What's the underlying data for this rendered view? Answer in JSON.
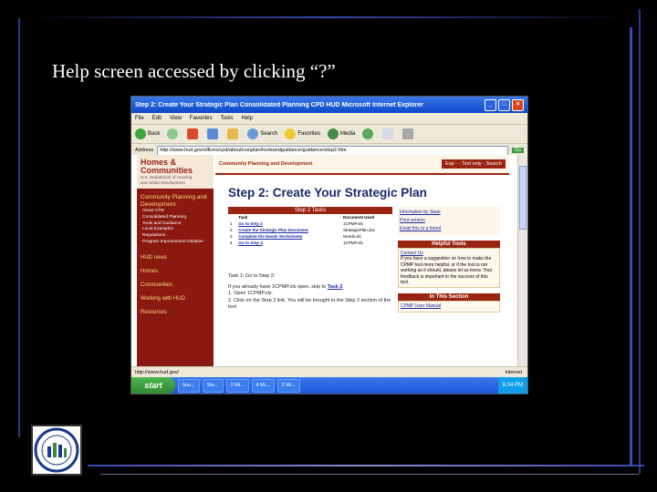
{
  "slide": {
    "title": "Help screen accessed by clicking “?”"
  },
  "window": {
    "title": "Step 2: Create Your Strategic Plan  Consolidated Planning  CPD  HUD  Microsoft Internet Explorer",
    "min": "_",
    "max": "□",
    "close": "×"
  },
  "menu": [
    "File",
    "Edit",
    "View",
    "Favorites",
    "Tools",
    "Help"
  ],
  "toolbar": {
    "back": "Back",
    "search": "Search",
    "favorites": "Favorites",
    "media": "Media"
  },
  "address": {
    "label": "Address",
    "value": "http://www.hud.gov/offices/cpd/about/conplan/toolsandguidance/guidance/step2.htm",
    "go": "Go"
  },
  "site": {
    "logo_line1": "Homes &",
    "logo_line2": "Communities",
    "logo_line3": "U.S. Department of Housing",
    "logo_line4": "and Urban Development",
    "cpd_header": "Community Planning and Development",
    "top_links": "Esp·· · Text only · Search",
    "section": "Community Planning and Development",
    "sub_items": [
      "About CPD",
      "Consolidated Planning",
      "Tools and Guidance",
      "Local Examples",
      "Regulations",
      "Program Improvement Initiative"
    ],
    "nav": [
      "HUD news",
      "Homes",
      "Communities",
      "Working with HUD",
      "Resources"
    ],
    "heading": "Step 2: Create Your Strategic Plan",
    "tasks_header": "Step 2 Tasks",
    "col_task": "Task",
    "col_doc": "Document Used",
    "tasks": [
      {
        "num": "1",
        "task": "Go to Step 2",
        "doc": "1CPMP.xls"
      },
      {
        "num": "2",
        "task": "Create the Strategic Plan Document",
        "doc": "StrategicPlan.doc"
      },
      {
        "num": "3",
        "task": "Complete the Needs Worksheets",
        "doc": "Needs.xls"
      },
      {
        "num": "4",
        "task": "Go to Step 3",
        "doc": "1CPMP.xls"
      }
    ],
    "body_title": "Task 1: Go to Step 2:",
    "body_p1": "If you already have 1CPMP.xls open, skip to",
    "body_link": "Task 2",
    "body_l1": "1.   Open 1CPMP.xls.",
    "body_l2": "2.   Click on the Step 2 link. You will be brought to the Step 2 section of the tool",
    "info_state": "Information by State",
    "print_version": "Print version",
    "email_friend": "Email this to a friend",
    "helpful_tools": "Helpful Tools",
    "contact_us": "Contact Us",
    "contact_text": "If you have a suggestion on how to make the CPMP tool more helpful, or if the tool is not working as it should, please let us know. Your feedback is important to the success of this tool.",
    "in_section": "In This Section",
    "user_manual": "CPMP User Manual"
  },
  "status": {
    "left": "http://www.hud.gov/",
    "right": "Internet"
  },
  "taskbar": {
    "start": "start",
    "tasks": [
      "hou...",
      "Ste...",
      "2 Mi...",
      "4 Mi...",
      "2 Mi..."
    ],
    "clock": "6:34 PM"
  },
  "colors": {
    "hud_maroon": "#8a1a10",
    "heading_blue": "#1a2a6a",
    "xp_blue": "#1c56d8"
  }
}
